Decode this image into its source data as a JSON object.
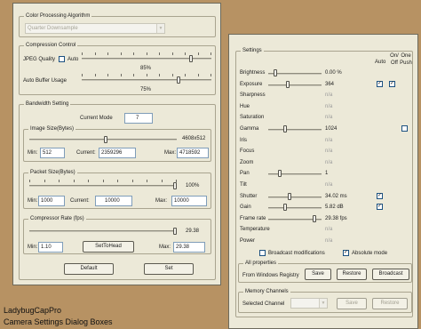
{
  "caption": {
    "line1": "LadybugCapPro",
    "line2": "Camera Settings Dialog Boxes"
  },
  "left": {
    "color_group_title": "Color Processing Algorithm",
    "color_algorithm_value": "Quarter Downsample",
    "compression_group_title": "Compression Control",
    "jpeg_quality_label": "JPEG Quality",
    "auto_label": "Auto",
    "jpeg_quality_value": "85%",
    "jpeg_quality_level": 0.85,
    "auto_buffer_label": "Auto Buffer Usage",
    "auto_buffer_value": "75%",
    "auto_buffer_level": 0.75,
    "bandwidth_group_title": "Bandwidth Setting",
    "current_mode_label": "Current Mode",
    "current_mode_value": "7",
    "image_size_title": "Image Size(Bytes)",
    "image_size_dims": "4608x512",
    "image_min_label": "Min:",
    "image_min_value": "512",
    "image_current_label": "Current:",
    "image_current_value": "2359296",
    "image_max_label": "Max:",
    "image_max_value": "4718592",
    "packet_size_title": "Packet Size(Bytes)",
    "packet_percent": "100%",
    "packet_min_label": "Min:",
    "packet_min_value": "1000",
    "packet_current_label": "Current:",
    "packet_current_value": "10000",
    "packet_max_label": "Max:",
    "packet_max_value": "10000",
    "compressor_title": "Compressor Rate (fps)",
    "compressor_value": "29.38",
    "compressor_min_label": "Min:",
    "compressor_min_value": "1.10",
    "set_to_head_label": "SetToHead",
    "compressor_max_label": "Max:",
    "compressor_max_value": "29.38",
    "default_label": "Default",
    "set_label": "Set"
  },
  "right": {
    "settings_title": "Settings",
    "col_auto": "Auto",
    "col_onoff": "On/ Off",
    "col_onepush": "One Push",
    "rows": [
      {
        "name": "Brightness",
        "value": "0.00 %",
        "slider": true,
        "level": 0.1,
        "enabled": true
      },
      {
        "name": "Exposure",
        "value": "364",
        "slider": true,
        "level": 0.35,
        "enabled": true,
        "auto": true,
        "onoff": true
      },
      {
        "name": "Sharpness",
        "value": "n/a",
        "enabled": false
      },
      {
        "name": "Hue",
        "value": "n/a",
        "enabled": false
      },
      {
        "name": "Saturation",
        "value": "n/a",
        "enabled": false
      },
      {
        "name": "Gamma",
        "value": "1024",
        "slider": true,
        "level": 0.3,
        "enabled": true,
        "onepush_box": true
      },
      {
        "name": "Iris",
        "value": "n/a",
        "enabled": false
      },
      {
        "name": "Focus",
        "value": "n/a",
        "enabled": false
      },
      {
        "name": "Zoom",
        "value": "n/a",
        "enabled": false
      },
      {
        "name": "Pan",
        "value": "1",
        "slider": true,
        "level": 0.2,
        "enabled": true
      },
      {
        "name": "Tilt",
        "value": "n/a",
        "enabled": false
      },
      {
        "name": "Shutter",
        "value": "34.02 ms",
        "slider": true,
        "level": 0.4,
        "enabled": true,
        "auto": true
      },
      {
        "name": "Gain",
        "value": "5.82 dB",
        "slider": true,
        "level": 0.3,
        "enabled": true,
        "auto": true
      },
      {
        "name": "Frame rate",
        "value": "29.38 fps",
        "slider": true,
        "level": 0.9,
        "enabled": true
      },
      {
        "name": "Temperature",
        "value": "n/a",
        "enabled": false
      },
      {
        "name": "Power",
        "value": "n/a",
        "enabled": false
      }
    ],
    "broadcast_label": "Broadcast modifications",
    "absolute_label": "Absolute mode",
    "all_props_title": "All properties",
    "from_registry_label": "From Windows Registry",
    "save_label": "Save",
    "restore_label": "Restore",
    "broadcast_btn_label": "Broadcast",
    "memory_title": "Memory Channels",
    "selected_channel_label": "Selected Channel",
    "mem_save_label": "Save",
    "mem_restore_label": "Restore"
  }
}
